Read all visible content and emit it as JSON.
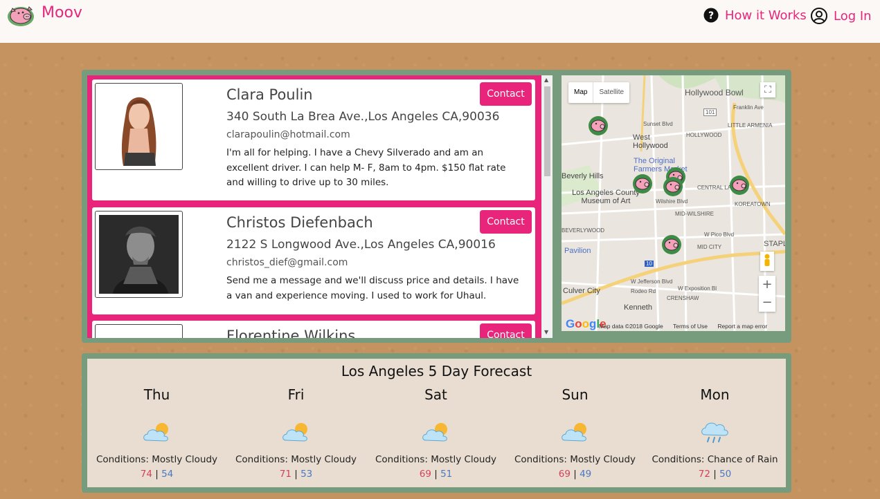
{
  "brand": {
    "name": "Moov"
  },
  "nav": {
    "how_it_works": "How it Works",
    "login": "Log In"
  },
  "movers": [
    {
      "name": "Clara Poulin",
      "address": "340 South La Brea Ave.,Los Angeles CA,90036",
      "email": "clarapoulin@hotmail.com",
      "bio": "I'm all for helping. I have a Chevy Silverado and am an excellent driver. I can help M- F, 8am to 4pm. $150 flat rate and willing to drive up to 30 miles.",
      "contact_label": "Contact"
    },
    {
      "name": "Christos Diefenbach",
      "address": "2122 S Longwood Ave.,Los Angeles CA,90016",
      "email": "christos_dief@gmail.com",
      "bio": "Send me a message and we'll discuss price and details. I have a van and experience moving. I used to work for Uhaul.",
      "contact_label": "Contact"
    },
    {
      "name": "Florentine Wilkins",
      "contact_label": "Contact"
    }
  ],
  "map": {
    "toggle_map": "Map",
    "toggle_satellite": "Satellite",
    "google": "Google",
    "footer": [
      "Map data ©2018 Google",
      "Terms of Use",
      "Report a map error"
    ],
    "labels": {
      "hollywood_bowl": "Hollywood Bowl",
      "franklin": "Franklin Ave",
      "sunset": "Sunset Blvd",
      "little_armenia": "LITTLE ARMENIA",
      "west_hollywood": "West Hollywood",
      "hollywood": "HOLLYWOOD",
      "original_farmers": "The Original Farmers Market",
      "beverly_hills": "Beverly Hills",
      "central_la": "CENTRAL LA",
      "lacma": "Los Angeles County Museum of Art",
      "wilshire": "Wilshire Blvd",
      "koreatown": "KOREATOWN",
      "mid_wilshire": "MID-WILSHIRE",
      "beverlywood": "BEVERLYWOOD",
      "pico": "W Pico Blvd",
      "mid_city": "MID CITY",
      "pavilion": "Pavilion",
      "staples": "STAPLE",
      "jefferson": "W Jefferson Blvd",
      "exposition": "W Exposition Bl",
      "rodeo": "Rodeo Rd",
      "crenshaw": "CRENSHAW",
      "culver_city": "Culver City",
      "kenneth": "Kenneth",
      "hwy_101": "101",
      "hwy_10": "10"
    }
  },
  "forecast": {
    "title": "Los Angeles 5 Day Forecast",
    "days": [
      {
        "day": "Thu",
        "condition": "Conditions: Mostly Cloudy",
        "high": "74",
        "low": "54",
        "icon": "partly-cloudy-icon"
      },
      {
        "day": "Fri",
        "condition": "Conditions: Mostly Cloudy",
        "high": "71",
        "low": "53",
        "icon": "partly-cloudy-icon"
      },
      {
        "day": "Sat",
        "condition": "Conditions: Mostly Cloudy",
        "high": "69",
        "low": "51",
        "icon": "partly-cloudy-icon"
      },
      {
        "day": "Sun",
        "condition": "Conditions: Mostly Cloudy",
        "high": "69",
        "low": "49",
        "icon": "partly-cloudy-icon"
      },
      {
        "day": "Mon",
        "condition": "Conditions: Chance of Rain",
        "high": "72",
        "low": "50",
        "icon": "rain-cloud-icon"
      }
    ],
    "separator": "|"
  },
  "colors": {
    "brand_pink": "#e8257b",
    "panel_green": "#779c7d",
    "high_temp": "#d2425a",
    "low_temp": "#4a78c2"
  }
}
